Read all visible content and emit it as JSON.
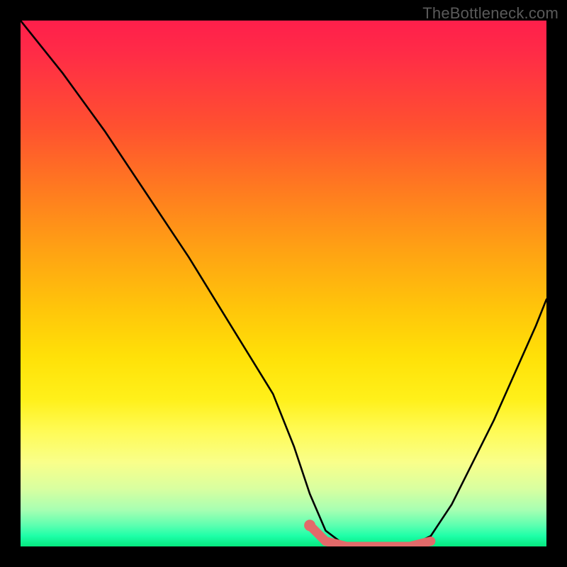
{
  "watermark": "TheBottleneck.com",
  "chart_data": {
    "type": "line",
    "title": "",
    "xlabel": "",
    "ylabel": "",
    "xlim": [
      0,
      100
    ],
    "ylim": [
      0,
      100
    ],
    "grid": false,
    "series": [
      {
        "name": "bottleneck-curve",
        "x": [
          0,
          8,
          16,
          24,
          32,
          40,
          48,
          52,
          55,
          58,
          62,
          66,
          70,
          74,
          78,
          82,
          86,
          90,
          94,
          98,
          100
        ],
        "values": [
          100,
          90,
          79,
          67,
          55,
          42,
          29,
          19,
          10,
          3,
          0,
          0,
          0,
          0,
          2,
          8,
          16,
          24,
          33,
          42,
          47
        ]
      },
      {
        "name": "highlight-segment",
        "x": [
          55,
          58,
          62,
          66,
          70,
          74,
          78
        ],
        "values": [
          4,
          1,
          0,
          0,
          0,
          0,
          1
        ]
      }
    ],
    "markers": [
      {
        "name": "highlight-dot",
        "x": 55,
        "y": 4
      }
    ],
    "colors": {
      "curve": "#000000",
      "highlight": "#e26a6a",
      "gradient_top": "#ff1f4b",
      "gradient_bottom": "#05e87f"
    }
  }
}
